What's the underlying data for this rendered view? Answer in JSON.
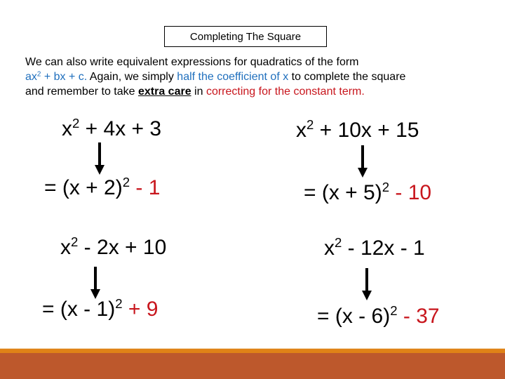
{
  "title": "Completing The Square",
  "intro": {
    "line1": "We can also  write equivalent expressions for quadratics of the form",
    "line2_form_a": "ax",
    "line2_form_sup": "2",
    "line2_form_b": " + bx + c.",
    "line2_mid": " Again, we simply ",
    "line2_half": "half the coefficient of x",
    "line2_end": " to complete the square",
    "line3_start": "and remember to take ",
    "line3_emph": "extra care",
    "line3_mid": " in ",
    "line3_red": "correcting for the constant term."
  },
  "colors": {
    "blue": "#1f6fbd",
    "red": "#c8161d",
    "footer_orange": "#e08217",
    "footer_rust": "#bd582c"
  },
  "examples": [
    {
      "expr_pre": "x",
      "expr_sup": "2",
      "expr_post": " + 4x + 3",
      "res_pre": "= (x + 2)",
      "res_sup": "2",
      "res_const": " - 1"
    },
    {
      "expr_pre": "x",
      "expr_sup": "2",
      "expr_post": " + 10x + 15",
      "res_pre": "= (x + 5)",
      "res_sup": "2",
      "res_const": " - 10"
    },
    {
      "expr_pre": "x",
      "expr_sup": "2",
      "expr_post": " - 2x + 10",
      "res_pre": "= (x - 1)",
      "res_sup": "2",
      "res_const": " + 9"
    },
    {
      "expr_pre": "x",
      "expr_sup": "2",
      "expr_post": "  - 12x - 1",
      "res_pre": "= (x - 6)",
      "res_sup": "2",
      "res_const": " - 37"
    }
  ]
}
